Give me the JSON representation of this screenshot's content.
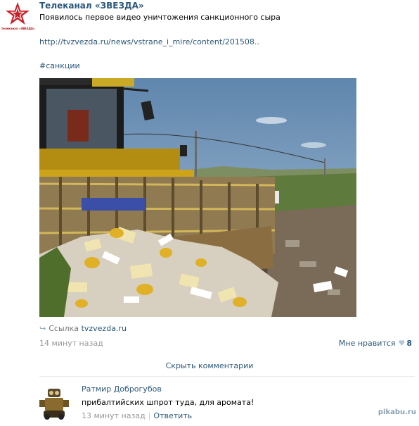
{
  "post": {
    "logo_text": "телеканал «ЗВЕЗДА»",
    "author": "Телеканал «ЗВЕЗДА»",
    "text": "Появилось первое видео уничтожения санкционного сыра",
    "link": "http://tvzvezda.ru/news/vstrane_i_mire/content/201508..",
    "hashtag": "#санкции",
    "share_label": "Ссылка",
    "share_domain": "tvzvezda.ru",
    "time": "14 минут назад",
    "like_label": "Мне нравится",
    "like_count": "8"
  },
  "comments": {
    "toggle_label": "Скрыть комментарии",
    "items": [
      {
        "author": "Ратмир Доброгубов",
        "text": "прибалтийских шпрот туда, для аромата!",
        "time": "13 минут назад",
        "reply_label": "Ответить"
      }
    ]
  },
  "watermark": "pikabu.ru",
  "colors": {
    "link": "#2b587a",
    "meta": "#999999",
    "brand_red": "#b7191a"
  }
}
